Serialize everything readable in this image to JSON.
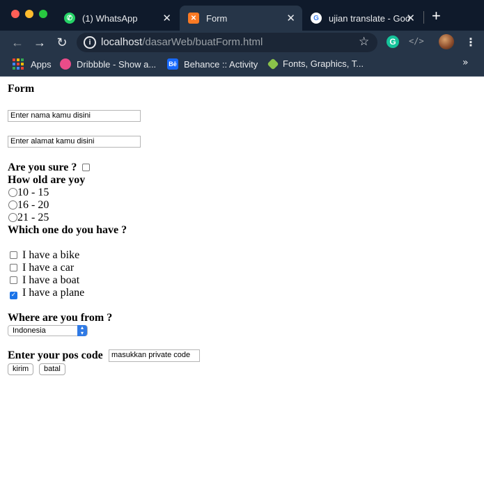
{
  "browser": {
    "tabs": [
      {
        "title": "(1) WhatsApp",
        "icon": "whatsapp-icon",
        "color": "#25d366"
      },
      {
        "title": "Form",
        "icon": "xampp-icon",
        "color": "#fb7a24"
      },
      {
        "title": "ujian translate - Goo",
        "icon": "google-icon",
        "color": "#4285f4"
      }
    ],
    "url_host": "localhost",
    "url_path": "/dasarWeb/buatForm.html",
    "bookmarks": [
      {
        "label": "Apps",
        "icon": "apps-grid-icon"
      },
      {
        "label": "Dribbble - Show a...",
        "icon": "dribbble-icon",
        "color": "#ea4c89"
      },
      {
        "label": "Behance :: Activity",
        "icon": "behance-icon",
        "color": "#1769ff"
      },
      {
        "label": "Fonts, Graphics, T...",
        "icon": "tag-icon",
        "color": "#8bc34a"
      }
    ]
  },
  "form": {
    "title": "Form",
    "name_placeholder": "Enter nama kamu disini",
    "address_placeholder": "Enter alamat kamu disini",
    "sure_label": "Are you sure ?",
    "sure_checked": false,
    "age_label": "How old are yoy",
    "age_options": [
      "10 - 15",
      "16 - 20",
      "21 - 25"
    ],
    "vehicle_label": "Which one do you have ?",
    "vehicles": [
      {
        "label": "I have a bike",
        "checked": false
      },
      {
        "label": "I have a car",
        "checked": false
      },
      {
        "label": "I have a boat",
        "checked": false
      },
      {
        "label": "I have a plane",
        "checked": true
      }
    ],
    "from_label": "Where are you from ?",
    "country_selected": "Indonesia",
    "pos_label": "Enter your pos code",
    "pos_placeholder": "masukkan private code",
    "submit_label": "kirim",
    "cancel_label": "batal"
  }
}
